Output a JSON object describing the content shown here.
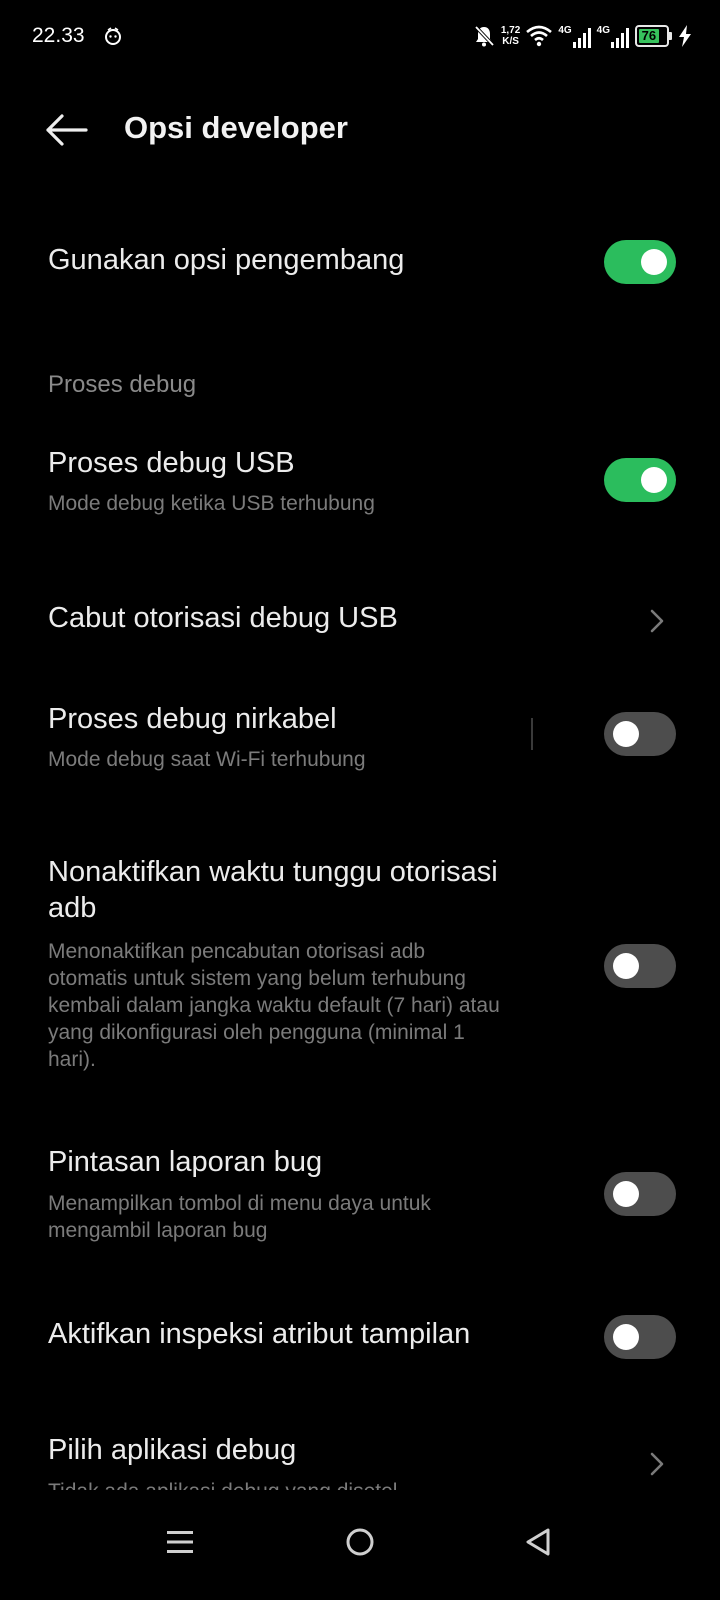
{
  "status_bar": {
    "time": "22.33",
    "speed_value": "1,72",
    "speed_unit": "K/S",
    "network_1": "4G",
    "network_2": "4G",
    "battery_level": "76",
    "battery_percent": 76,
    "icons": [
      "alarm-icon",
      "mute-bell-icon",
      "wifi-icon",
      "signal-icon",
      "signal-icon",
      "battery-icon",
      "charging-bolt-icon"
    ]
  },
  "header": {
    "back_icon": "arrow-left-icon",
    "title": "Opsi developer"
  },
  "settings": {
    "developer_options": {
      "title": "Gunakan opsi pengembang",
      "enabled": true
    },
    "section_debug": "Proses debug",
    "usb_debugging": {
      "title": "Proses debug USB",
      "subtitle": "Mode debug ketika USB terhubung",
      "enabled": true
    },
    "revoke_usb": {
      "title": "Cabut otorisasi debug USB"
    },
    "wireless_debugging": {
      "title": "Proses debug nirkabel",
      "subtitle": "Mode debug saat Wi-Fi terhubung",
      "enabled": false
    },
    "adb_timeout": {
      "title_line1": "Nonaktifkan waktu tunggu otorisasi",
      "title_line2": "adb",
      "subtitle_lines": [
        "Menonaktifkan pencabutan otorisasi adb",
        "otomatis untuk sistem yang belum terhubung",
        "kembali dalam jangka waktu default (7 hari) atau",
        "yang dikonfigurasi oleh pengguna (minimal 1",
        "hari)."
      ],
      "enabled": false
    },
    "bug_report": {
      "title": "Pintasan laporan bug",
      "subtitle_lines": [
        "Menampilkan tombol di menu daya untuk",
        "mengambil laporan bug"
      ],
      "enabled": false
    },
    "view_attribute": {
      "title": "Aktifkan inspeksi atribut tampilan",
      "enabled": false
    },
    "debug_app": {
      "title": "Pilih aplikasi debug",
      "subtitle": "Tidak ada aplikasi debug yang disetel"
    }
  },
  "nav_bar": {
    "icons": [
      "menu-icon",
      "home-icon",
      "back-triangle-icon"
    ]
  },
  "colors": {
    "background": "#000000",
    "toggle_on": "#2bbd5d",
    "toggle_off": "#4d4d4d",
    "secondary_text": "#7b7b7b"
  }
}
